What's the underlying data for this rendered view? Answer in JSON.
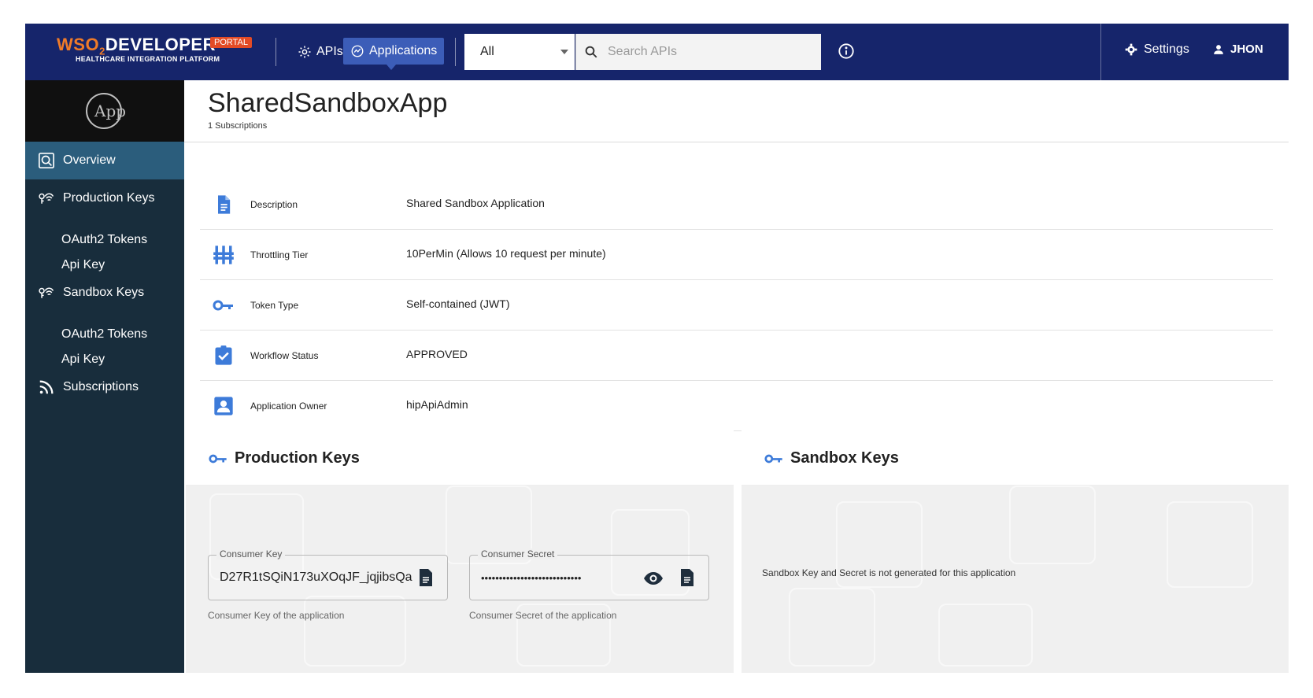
{
  "topbar": {
    "brand_prefix": "WSO",
    "brand_two": "2",
    "brand_name": "DEVELOPER",
    "brand_badge": "PORTAL",
    "brand_subtitle": "HEALTHCARE INTEGRATION PLATFORM",
    "nav_apis": "APIs",
    "nav_applications": "Applications",
    "search_scope": "All",
    "search_placeholder": "Search APIs",
    "settings_label": "Settings",
    "user_label": "JHON"
  },
  "sidebar": {
    "logo_text": "App",
    "items": [
      {
        "label": "Overview",
        "icon": "overview-icon",
        "active": true
      },
      {
        "label": "Production Keys",
        "icon": "keys-icon"
      },
      {
        "label": "OAuth2 Tokens"
      },
      {
        "label": "Api Key"
      },
      {
        "label": "Sandbox Keys",
        "icon": "keys-icon"
      },
      {
        "label": "OAuth2 Tokens"
      },
      {
        "label": "Api Key"
      },
      {
        "label": "Subscriptions",
        "icon": "rss-icon"
      }
    ]
  },
  "app": {
    "name": "SharedSandboxApp",
    "subscriptions": "1 Subscriptions"
  },
  "details": [
    {
      "label": "Description",
      "value": "Shared Sandbox Application",
      "icon": "document-icon"
    },
    {
      "label": "Throttling Tier",
      "value": "10PerMin (Allows 10 request per minute)",
      "icon": "tier-icon"
    },
    {
      "label": "Token Type",
      "value": "Self-contained (JWT)",
      "icon": "key-icon"
    },
    {
      "label": "Workflow Status",
      "value": "APPROVED",
      "icon": "clipboard-check-icon"
    },
    {
      "label": "Application Owner",
      "value": "hipApiAdmin",
      "icon": "owner-icon"
    }
  ],
  "production": {
    "title": "Production Keys",
    "consumer_key_label": "Consumer Key",
    "consumer_key_value": "D27R1tSQiN173uXOqJF_jqjibsQa",
    "consumer_key_helper": "Consumer Key of the application",
    "consumer_secret_label": "Consumer Secret",
    "consumer_secret_value": "••••••••••••••••••••••••••••",
    "consumer_secret_helper": "Consumer Secret of the application"
  },
  "sandbox": {
    "title": "Sandbox Keys",
    "message": "Sandbox Key and Secret is not generated for this application"
  },
  "colors": {
    "topbar": "#16256b",
    "active_nav": "#3c5db8",
    "sidebar": "#182d3c",
    "sidebar_active": "#2b5d7c",
    "icon_blue": "#3d7bd9",
    "brand_orange": "#f07b28"
  }
}
